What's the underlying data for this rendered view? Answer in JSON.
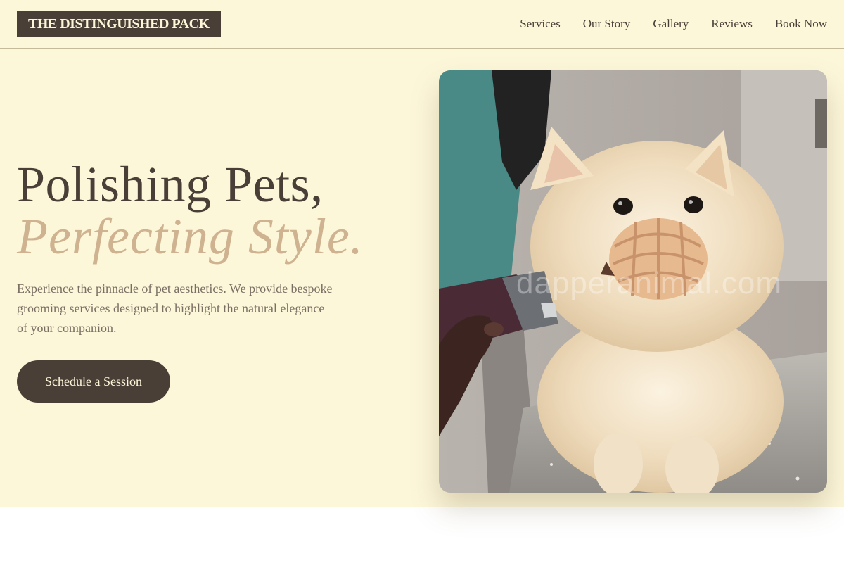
{
  "header": {
    "logo_text": "THE DISTINGUISHED PACK",
    "nav": [
      {
        "label": "Services"
      },
      {
        "label": "Our Story"
      },
      {
        "label": "Gallery"
      },
      {
        "label": "Reviews"
      },
      {
        "label": "Book Now"
      }
    ]
  },
  "hero": {
    "headline_line1": "Polishing Pets,",
    "headline_line2": "Perfecting Style.",
    "lead": "Experience the pinnacle of pet aesthetics. We provide bespoke grooming services designed to highlight the natural elegance of your companion.",
    "cta_label": "Schedule a Session",
    "image": {
      "watermark": "dapperanimal.com"
    }
  },
  "colors": {
    "background": "#fdf7da",
    "primary": "#4a3f37",
    "accent": "#cfb391",
    "muted_text": "#7a6e63"
  }
}
